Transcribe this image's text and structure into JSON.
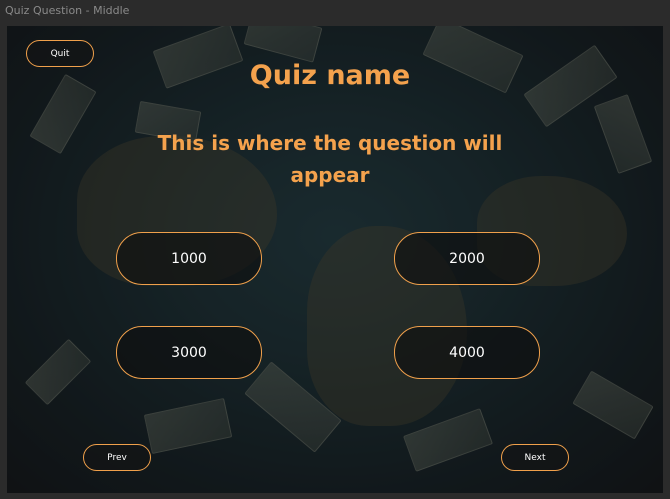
{
  "window": {
    "title": "Quiz Question - Middle"
  },
  "quiz": {
    "quit_label": "Quit",
    "name": "Quiz name",
    "question": "This is where the question will appear",
    "answers": [
      "1000",
      "2000",
      "3000",
      "4000"
    ],
    "prev_label": "Prev",
    "next_label": "Next"
  },
  "colors": {
    "accent": "#f4a24d",
    "button_text": "#ffffff",
    "frame_bg": "#2b2b2b"
  }
}
